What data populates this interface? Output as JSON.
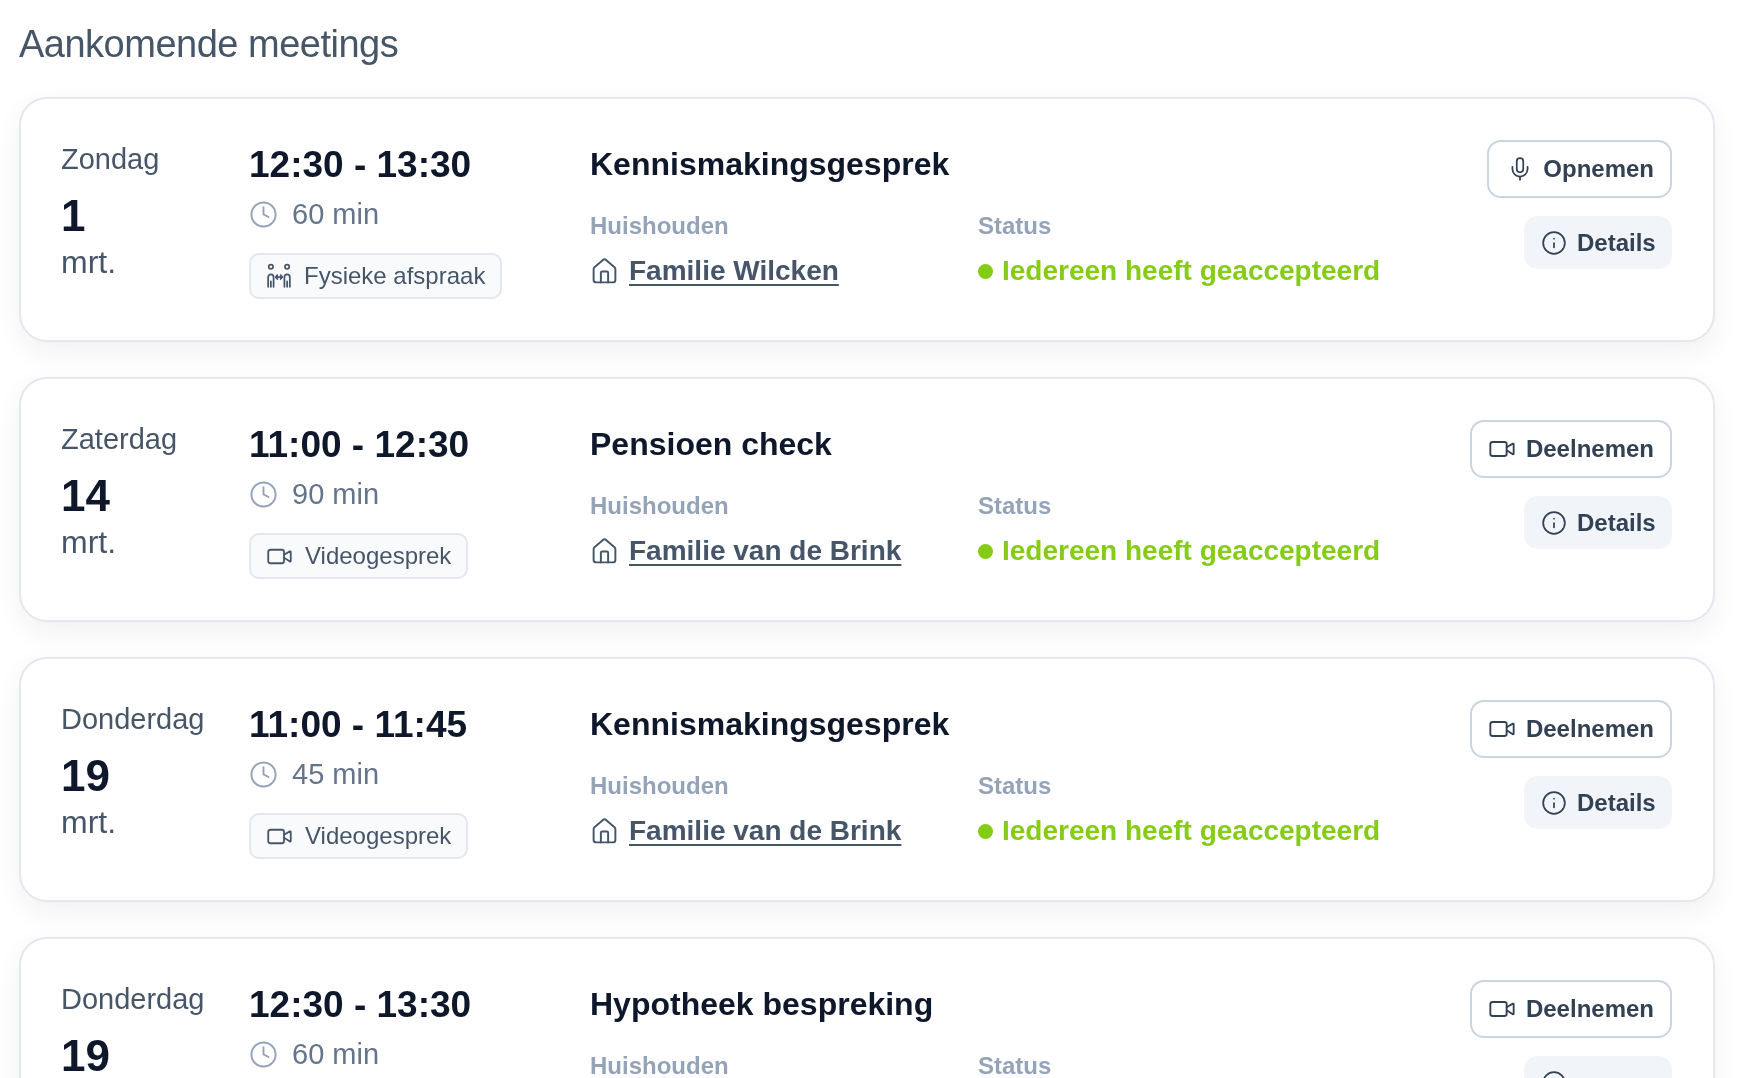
{
  "page_title": "Aankomende meetings",
  "meetings": [
    {
      "day": "Zondag",
      "date": "1",
      "month": "mrt.",
      "time": "12:30 - 13:30",
      "duration": "60 min",
      "type": {
        "kind": "in_person",
        "label": "Fysieke afspraak"
      },
      "title": "Kennismakingsgesprek",
      "household": {
        "label": "Huishouden",
        "name": "Familie Wilcken"
      },
      "status": {
        "label": "Status",
        "text": "Iedereen heeft geaccepteerd",
        "color": "#84cc16"
      },
      "actions": [
        {
          "kind": "record",
          "label": "Opnemen"
        },
        {
          "kind": "details",
          "label": "Details"
        }
      ]
    },
    {
      "day": "Zaterdag",
      "date": "14",
      "month": "mrt.",
      "time": "11:00 - 12:30",
      "duration": "90 min",
      "type": {
        "kind": "video",
        "label": "Videogesprek"
      },
      "title": "Pensioen check",
      "household": {
        "label": "Huishouden",
        "name": "Familie van de Brink"
      },
      "status": {
        "label": "Status",
        "text": "Iedereen heeft geaccepteerd",
        "color": "#84cc16"
      },
      "actions": [
        {
          "kind": "join",
          "label": "Deelnemen"
        },
        {
          "kind": "details",
          "label": "Details"
        }
      ]
    },
    {
      "day": "Donderdag",
      "date": "19",
      "month": "mrt.",
      "time": "11:00 - 11:45",
      "duration": "45 min",
      "type": {
        "kind": "video",
        "label": "Videogesprek"
      },
      "title": "Kennismakingsgesprek",
      "household": {
        "label": "Huishouden",
        "name": "Familie van de Brink"
      },
      "status": {
        "label": "Status",
        "text": "Iedereen heeft geaccepteerd",
        "color": "#84cc16"
      },
      "actions": [
        {
          "kind": "join",
          "label": "Deelnemen"
        },
        {
          "kind": "details",
          "label": "Details"
        }
      ]
    },
    {
      "day": "Donderdag",
      "date": "19",
      "time": "12:30 - 13:30",
      "duration": "60 min",
      "title": "Hypotheek bespreking",
      "household": {
        "label": "Huishouden"
      },
      "status": {
        "label": "Status"
      },
      "actions": [
        {
          "kind": "join",
          "label": "Deelnemen"
        },
        {
          "kind": "details"
        }
      ]
    }
  ]
}
